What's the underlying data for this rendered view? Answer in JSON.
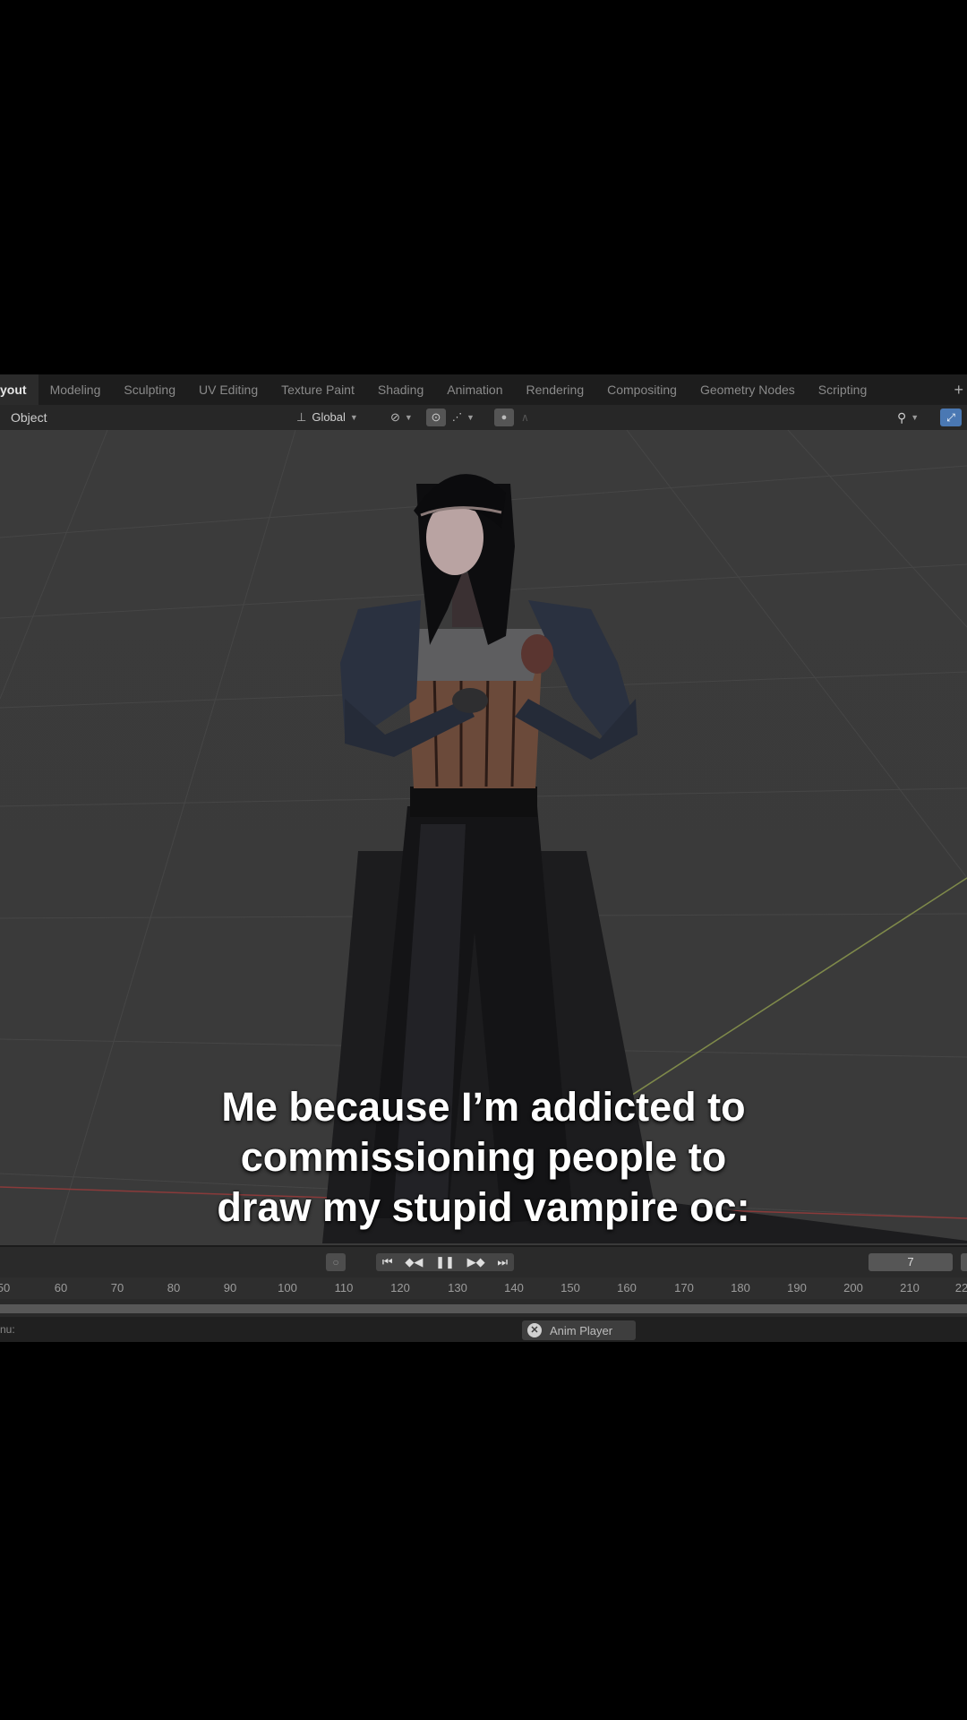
{
  "workspace_tabs": [
    "yout",
    "Modeling",
    "Sculpting",
    "UV Editing",
    "Texture Paint",
    "Shading",
    "Animation",
    "Rendering",
    "Compositing",
    "Geometry Nodes",
    "Scripting"
  ],
  "header": {
    "mode": "Object",
    "orientation": "Global"
  },
  "caption": {
    "line1": "Me because I’m addicted to",
    "line2": "commissioning people to",
    "line3": "draw my stupid vampire oc:"
  },
  "timeline": {
    "current_frame": "7",
    "ticks": [
      "50",
      "60",
      "70",
      "80",
      "90",
      "100",
      "110",
      "120",
      "130",
      "140",
      "150",
      "160",
      "170",
      "180",
      "190",
      "200",
      "210",
      "22"
    ]
  },
  "status": {
    "left_text": "nu:",
    "chip_label": "Anim Player"
  },
  "icons": [
    "plus-icon",
    "orientation-icon",
    "pivot-icon",
    "snap-icon",
    "proportional-icon",
    "gizmo-icon",
    "view-icon",
    "record-icon",
    "jump-start-icon",
    "keyframe-prev-icon",
    "pause-icon",
    "keyframe-next-icon",
    "jump-end-icon",
    "close-icon"
  ],
  "colors": {
    "viewport_bg": "#3a3a3a",
    "active_view_button": "#4a78b3",
    "caption_text": "#ffffff"
  }
}
